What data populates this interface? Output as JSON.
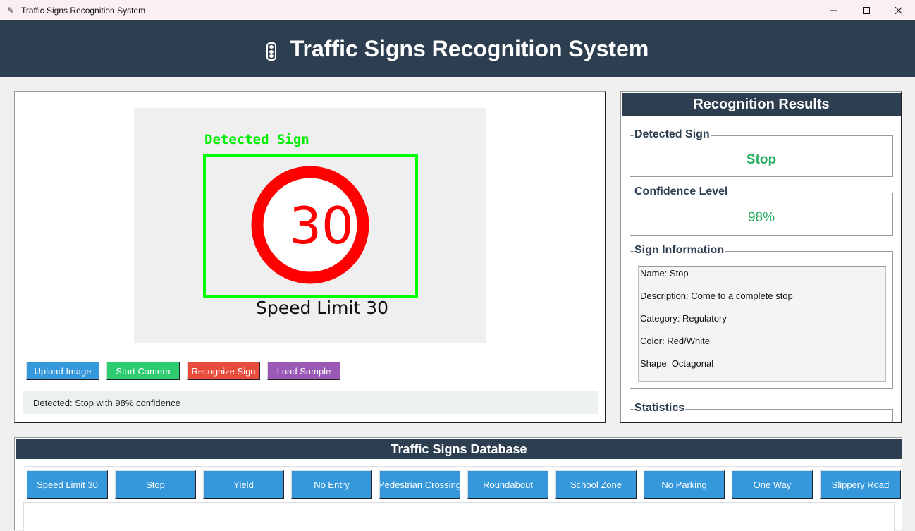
{
  "window": {
    "title": "Traffic Signs Recognition System",
    "minimize": "—",
    "maximize": "☐",
    "close": "✕"
  },
  "header": {
    "title": "Traffic Signs Recognition System",
    "icon": "traffic-light-icon"
  },
  "image_panel": {
    "overlay_label": "Detected Sign",
    "sign_number": "30",
    "sign_caption": "Speed Limit 30",
    "colors": {
      "box": "#00ff00",
      "ring": "#ff0000",
      "background": "#efefef"
    }
  },
  "actions": [
    {
      "label": "Upload Image",
      "color": "#3498db"
    },
    {
      "label": "Start Camera",
      "color": "#2ecc71"
    },
    {
      "label": "Recognize Sign",
      "color": "#e74c3c"
    },
    {
      "label": "Load Sample",
      "color": "#9b59b6"
    }
  ],
  "status": "Detected: Stop with 98% confidence",
  "results": {
    "title": "Recognition Results",
    "detected_sign_label": "Detected Sign",
    "detected_sign_value": "Stop",
    "confidence_label": "Confidence Level",
    "confidence_value": "98%",
    "info_label": "Sign Information",
    "info": [
      "Name: Stop",
      "Description: Come to a complete stop",
      "Category: Regulatory",
      "Color: Red/White",
      "Shape: Octagonal"
    ],
    "statistics_label": "Statistics"
  },
  "database": {
    "title": "Traffic Signs Database",
    "signs": [
      "Speed Limit 30",
      "Stop",
      "Yield",
      "No Entry",
      "Pedestrian Crossing",
      "Roundabout",
      "School Zone",
      "No Parking",
      "One Way",
      "Slippery Road"
    ]
  }
}
